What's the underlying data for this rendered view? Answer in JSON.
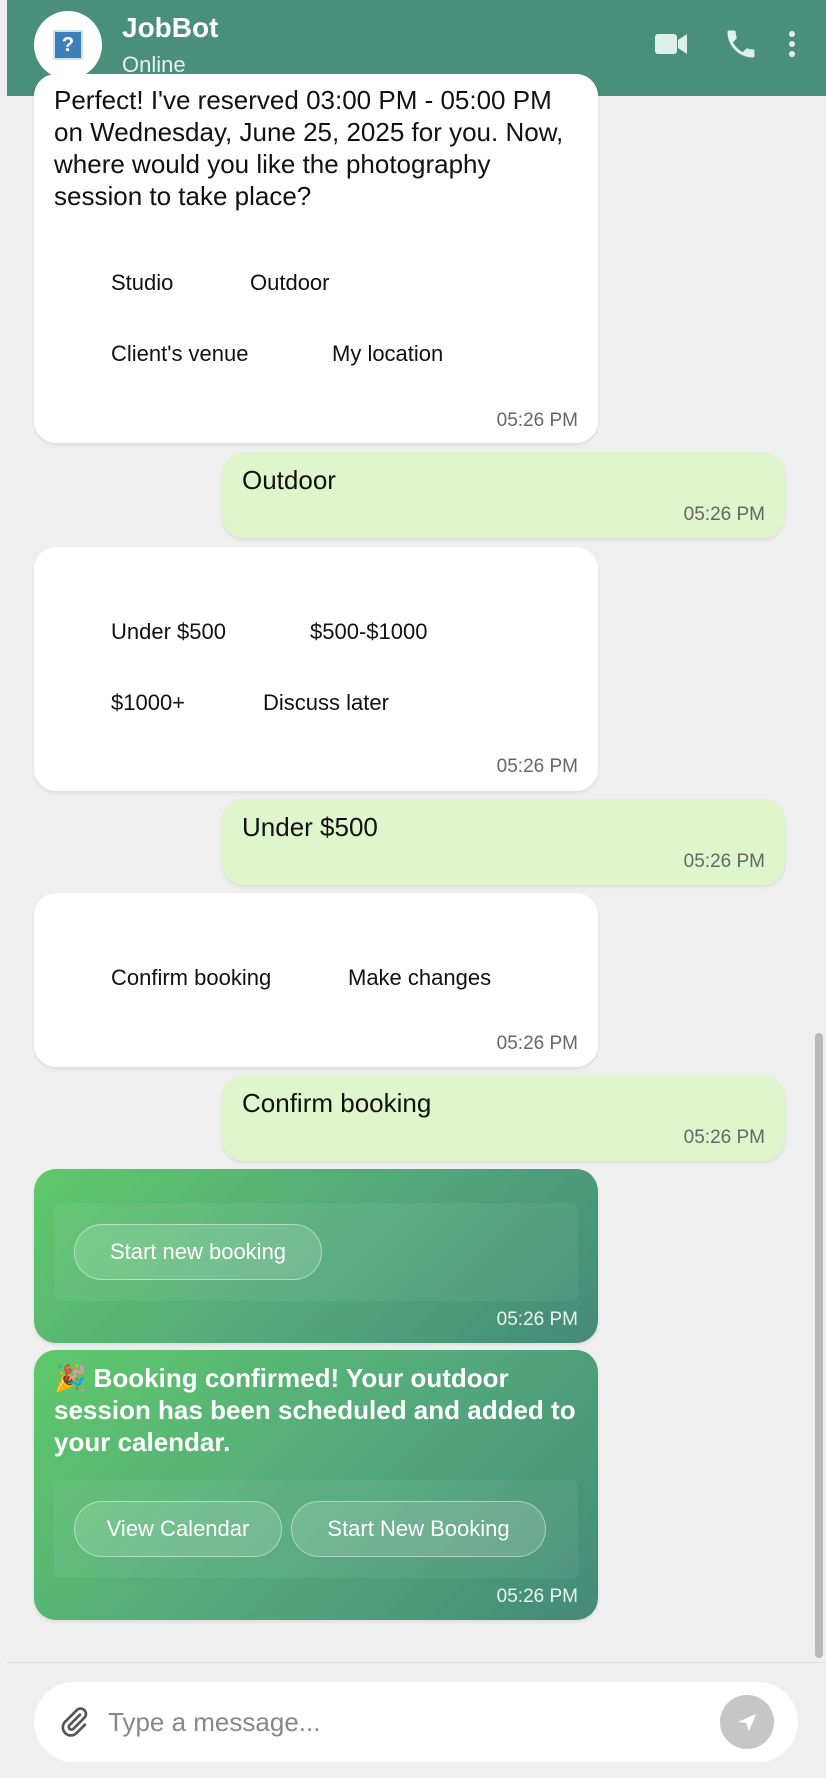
{
  "header": {
    "bot_name": "JobBot",
    "status": "Online",
    "avatar_glyph": "?",
    "icons": [
      "video-call-icon",
      "phone-call-icon",
      "more-options-icon"
    ]
  },
  "messages": {
    "m1": {
      "text": "Perfect! I've reserved 03:00 PM - 05:00 PM on Wednesday, June 25, 2025 for you. Now, where would you like the photography session to take place?",
      "options": [
        "Studio",
        "Outdoor",
        "Client's venue",
        "My location"
      ],
      "time": "05:26 PM"
    },
    "m2": {
      "text": "Outdoor",
      "time": "05:26 PM"
    },
    "m3": {
      "options": [
        "Under $500",
        "$500-$1000",
        "$1000+",
        "Discuss later"
      ],
      "time": "05:26 PM"
    },
    "m4": {
      "text": "Under $500",
      "time": "05:26 PM"
    },
    "m5": {
      "options": [
        "Confirm booking",
        "Make changes"
      ],
      "time": "05:26 PM"
    },
    "m6": {
      "text": "Confirm booking",
      "time": "05:26 PM"
    },
    "m7": {
      "buttons": [
        "Start new booking"
      ],
      "time": "05:26 PM"
    },
    "m8": {
      "emoji": "🎉",
      "text": "Booking confirmed! Your outdoor session has been scheduled and added to your calendar.",
      "buttons": [
        "View Calendar",
        "Start New Booking"
      ],
      "time": "05:26 PM"
    }
  },
  "composer": {
    "placeholder": "Type a message..."
  },
  "colors": {
    "header": "#4a8f7a",
    "user_bubble": "#dff5cc",
    "bot_bubble": "#ffffff",
    "success_gradient_start": "#5fc96a",
    "success_gradient_end": "#458a78"
  }
}
